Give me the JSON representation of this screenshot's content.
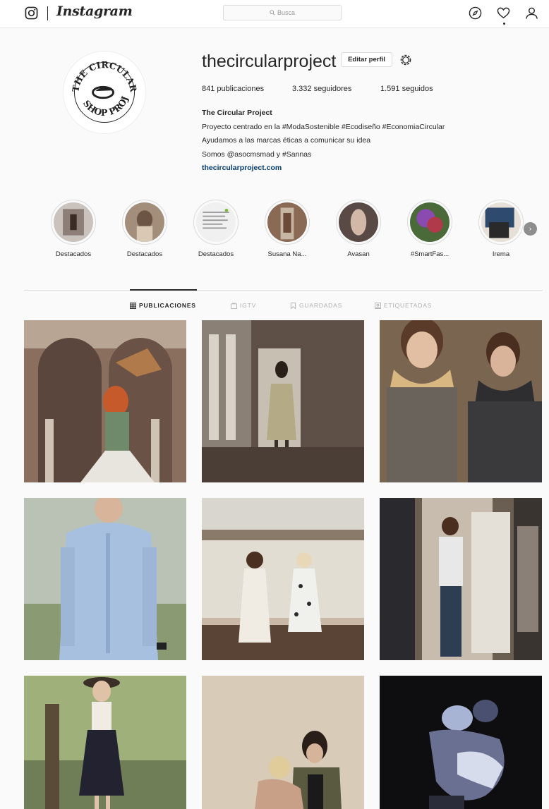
{
  "nav": {
    "wordmark": "Instagram",
    "search_placeholder": "Busca"
  },
  "profile": {
    "username": "thecircularproject",
    "edit_label": "Editar perfil",
    "stats": {
      "posts": "841 publicaciones",
      "followers": "3.332 seguidores",
      "following": "1.591 seguidos"
    },
    "bio": {
      "name": "The Circular Project",
      "line1": "Proyecto centrado en la #ModaSostenible #Ecodiseño #EconomiaCircular",
      "line2": "Ayudamos a las marcas éticas a comunicar su idea",
      "line3": "Somos @asocmsmad y #Sannas",
      "link": "thecircularproject.com"
    },
    "avatar_logo_text": "THE CIRCULAR PROJECT SHOP"
  },
  "highlights": [
    {
      "label": "Destacados",
      "color": "#9b8f8a"
    },
    {
      "label": "Destacados",
      "color": "#7a6a5f"
    },
    {
      "label": "Destacados",
      "color": "#e9e9e9"
    },
    {
      "label": "Susana Na...",
      "color": "#6b5244"
    },
    {
      "label": "Avasan",
      "color": "#5a4a45"
    },
    {
      "label": "#SmartFas...",
      "color": "#6a4a8a"
    },
    {
      "label": "Irema",
      "color": "#2e4a6e"
    }
  ],
  "tabs": [
    {
      "label": "PUBLICACIONES",
      "icon": "grid-icon",
      "active": true
    },
    {
      "label": "IGTV",
      "icon": "tv-icon",
      "active": false
    },
    {
      "label": "GUARDADAS",
      "icon": "bookmark-icon",
      "active": false
    },
    {
      "label": "ETIQUETADAS",
      "icon": "tag-icon",
      "active": false
    }
  ],
  "posts": [
    {
      "desc": "woman-with-owl",
      "bg": "#8a6f5e"
    },
    {
      "desc": "woman-in-hall",
      "bg": "#5e5046"
    },
    {
      "desc": "couple-with-scarves",
      "bg": "#7a6550"
    },
    {
      "desc": "man-blue-shirt",
      "bg": "#9fb2c9"
    },
    {
      "desc": "two-women-salt-flats",
      "bg": "#c9b8a6"
    },
    {
      "desc": "fitting-room",
      "bg": "#6a5e52"
    },
    {
      "desc": "woman-with-hat",
      "bg": "#6f7e56"
    },
    {
      "desc": "two-women-sitting",
      "bg": "#d8cbb8"
    },
    {
      "desc": "dark-embrace",
      "bg": "#111111"
    }
  ]
}
